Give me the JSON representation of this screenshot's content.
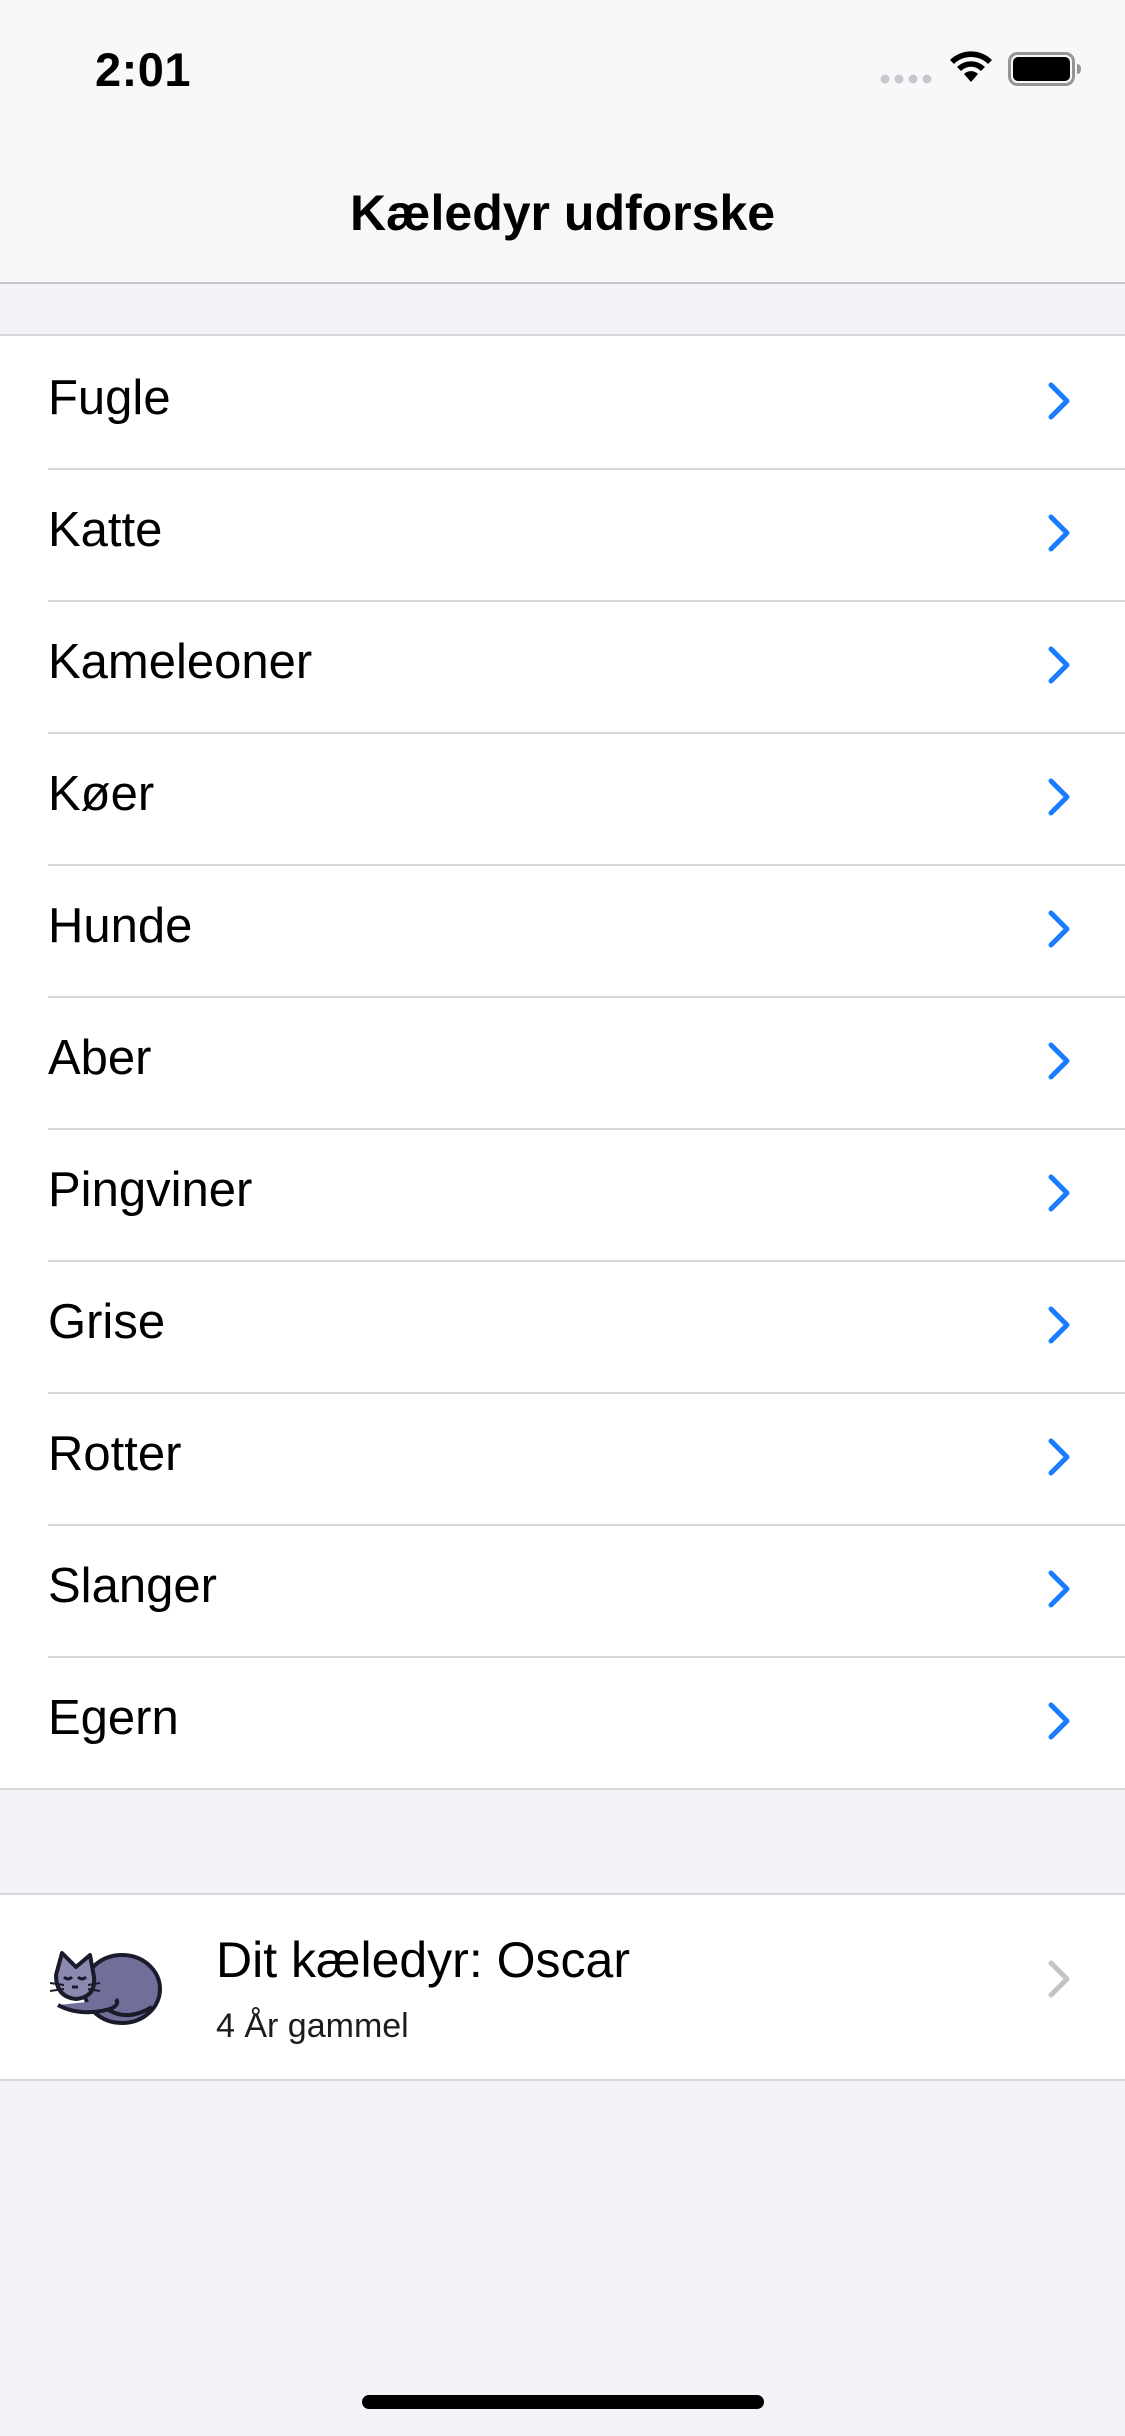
{
  "status_bar": {
    "time": "2:01"
  },
  "nav": {
    "title": "Kæledyr udforske"
  },
  "list": {
    "items": [
      {
        "label": "Fugle"
      },
      {
        "label": "Katte"
      },
      {
        "label": "Kameleoner"
      },
      {
        "label": "Køer"
      },
      {
        "label": "Hunde"
      },
      {
        "label": "Aber"
      },
      {
        "label": "Pingviner"
      },
      {
        "label": "Grise"
      },
      {
        "label": "Rotter"
      },
      {
        "label": "Slanger"
      },
      {
        "label": "Egern"
      }
    ],
    "chevron_icon": "chevron-right-icon",
    "accent_color": "#1a7cff"
  },
  "pet": {
    "name_line": "Dit kæledyr: Oscar",
    "age_line": "4 År gammel",
    "avatar_icon": "sleeping-cat-icon"
  }
}
